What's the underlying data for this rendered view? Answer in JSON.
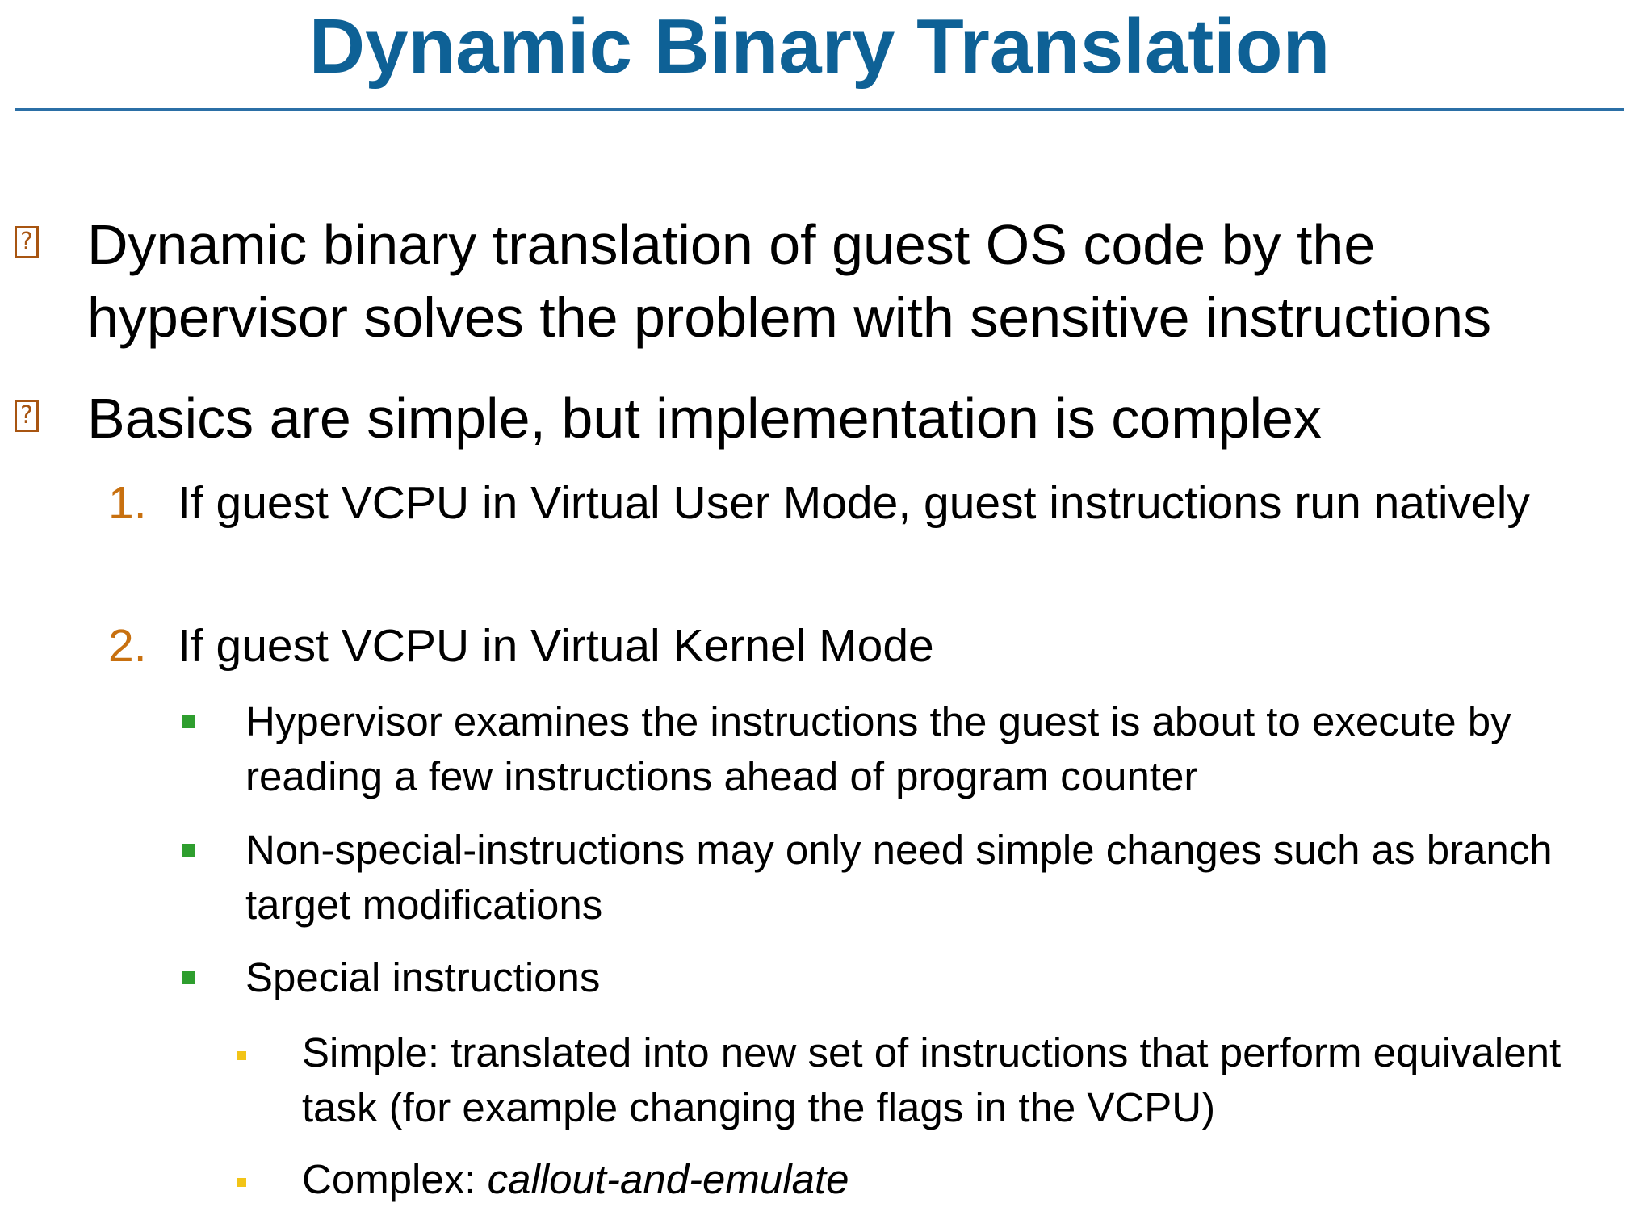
{
  "slide": {
    "title": "Dynamic Binary Translation"
  },
  "items": {
    "b1": {
      "marker": "?",
      "text": "Dynamic binary translation of guest OS code by the hypervisor solves the problem with sensitive instructions"
    },
    "b2": {
      "marker": "?",
      "text": "Basics are simple, but implementation is complex"
    },
    "n1": {
      "number": "1.",
      "text": "If guest VCPU in Virtual User Mode, guest instructions run natively"
    },
    "n2": {
      "number": "2.",
      "text": "If guest VCPU in Virtual Kernel Mode"
    },
    "s1": {
      "text": "Hypervisor examines the instructions the guest is about to execute by reading a few instructions ahead of program counter"
    },
    "s2": {
      "text": "Non-special-instructions may only need simple changes such as branch target modifications"
    },
    "s3": {
      "text": "Special instructions"
    },
    "t1": {
      "text": "Simple: translated into new set of instructions that perform equivalent task (for example changing the flags in the VCPU)"
    },
    "t2": {
      "prefix": "Complex: ",
      "emphasis": "callout-and-emulate"
    }
  },
  "colors": {
    "title": "#0E6196",
    "rule": "#2B6FA6",
    "level1_marker": "#A85511",
    "number": "#C8700F",
    "level3_marker": "#2E9E2E",
    "level4_marker": "#F2C417"
  },
  "icons": {
    "level1_marker": "missing-glyph-box-icon",
    "level3_marker": "green-square-bullet-icon",
    "level4_marker": "yellow-square-bullet-icon"
  }
}
